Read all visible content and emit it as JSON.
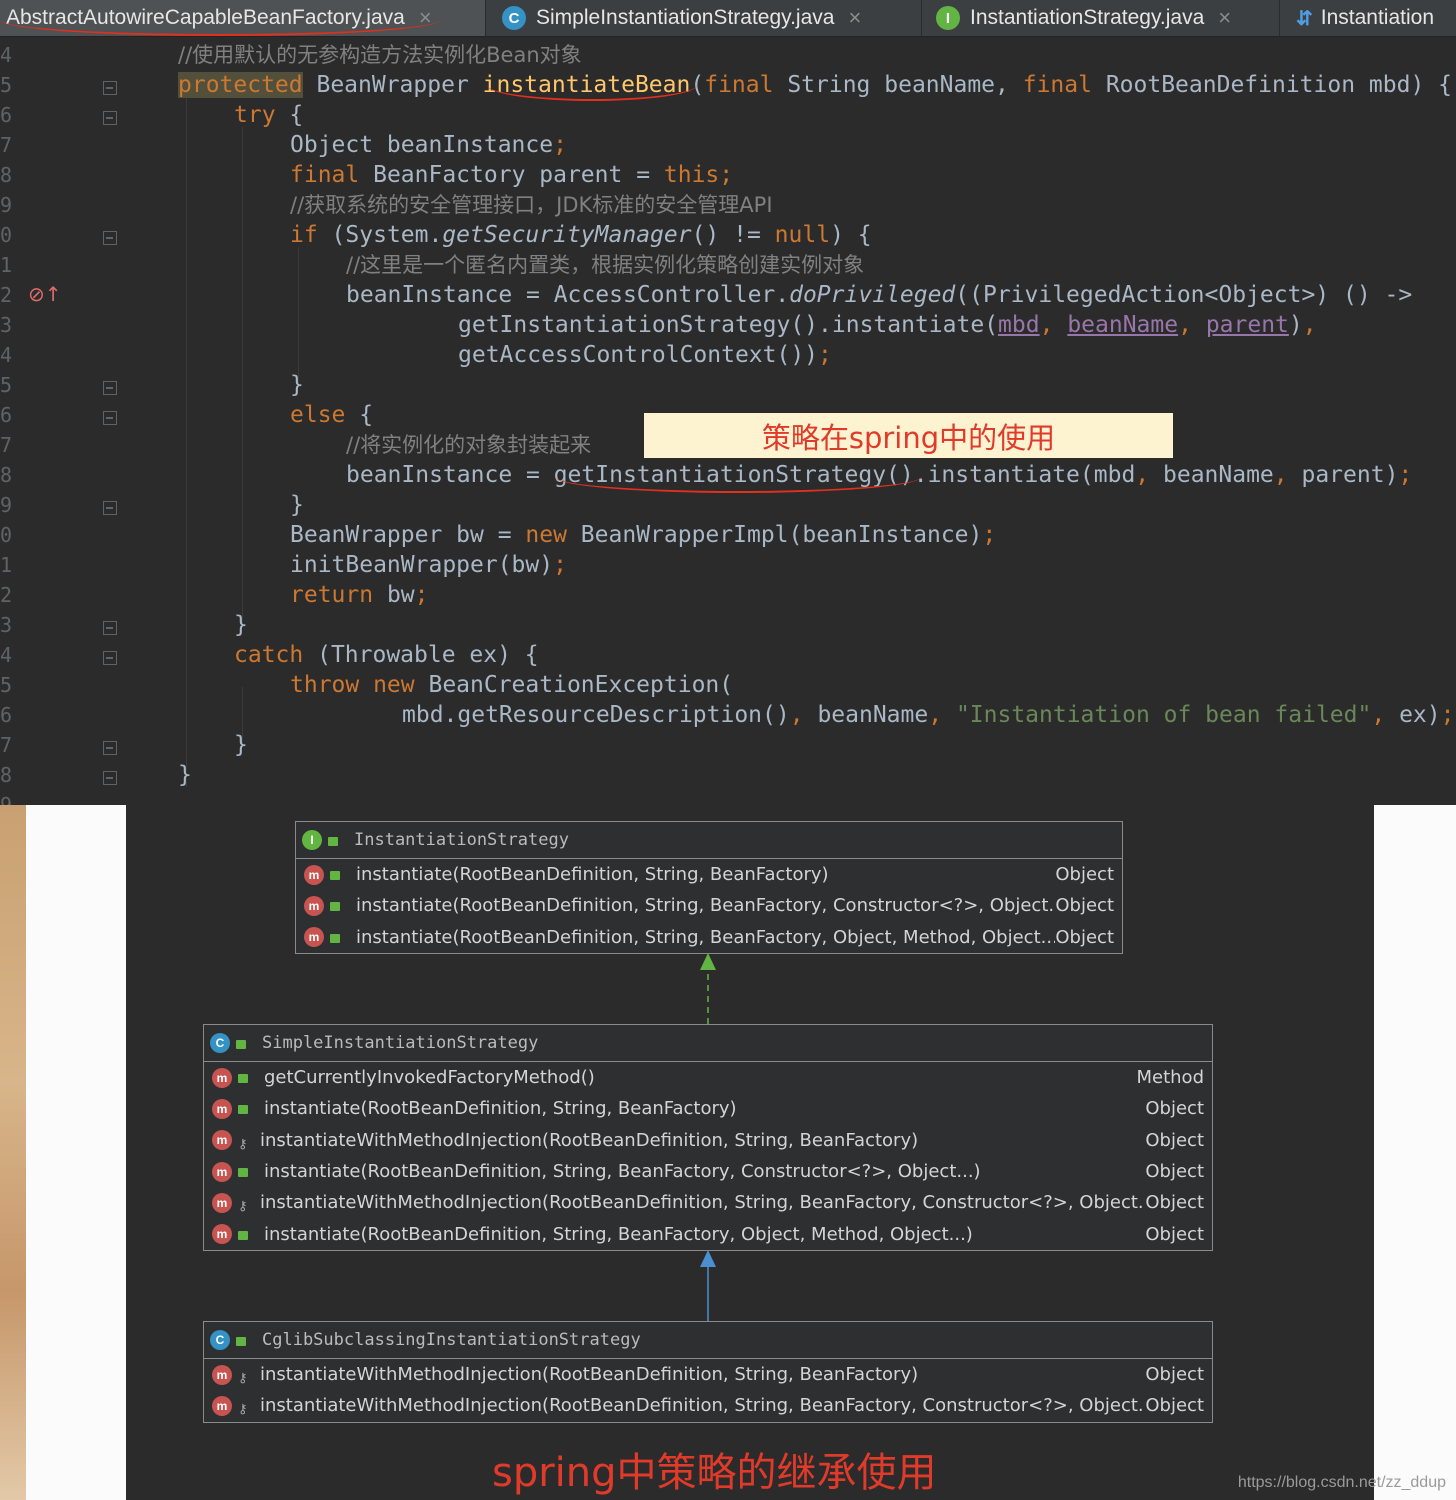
{
  "tabs": [
    {
      "label": "AbstractAutowireCapableBeanFactory.java",
      "icon": "none",
      "active": true
    },
    {
      "label": "SimpleInstantiationStrategy.java",
      "icon": "class-icon",
      "letter": "C"
    },
    {
      "label": "InstantiationStrategy.java",
      "icon": "interface-icon",
      "letter": "I"
    },
    {
      "label": "Instantiation",
      "icon": "structure-icon"
    }
  ],
  "tab_close_glyph": "×",
  "gutter_numbers": [
    "4",
    "5",
    "6",
    "7",
    "8",
    "9",
    "0",
    "1",
    "2",
    "3",
    "4",
    "5",
    "6",
    "7",
    "8",
    "9",
    "0",
    "1",
    "2",
    "3",
    "4",
    "5",
    "6",
    "7",
    "8",
    "9"
  ],
  "callout": "策略在spring中的使用",
  "diagram": {
    "interface": {
      "letter": "I",
      "name": "InstantiationStrategy",
      "methods": [
        {
          "sig": "instantiate(RootBeanDefinition, String, BeanFactory)",
          "ret": "Object"
        },
        {
          "sig": "instantiate(RootBeanDefinition, String, BeanFactory, Constructor<?>, Object...)",
          "ret": "Object"
        },
        {
          "sig": "instantiate(RootBeanDefinition, String, BeanFactory, Object, Method, Object...)",
          "ret": "Object"
        }
      ]
    },
    "simple": {
      "letter": "C",
      "name": "SimpleInstantiationStrategy",
      "methods": [
        {
          "sig": "getCurrentlyInvokedFactoryMethod()",
          "ret": "Method",
          "access": "public"
        },
        {
          "sig": "instantiate(RootBeanDefinition, String, BeanFactory)",
          "ret": "Object",
          "access": "public"
        },
        {
          "sig": "instantiateWithMethodInjection(RootBeanDefinition, String, BeanFactory)",
          "ret": "Object",
          "access": "protected"
        },
        {
          "sig": "instantiate(RootBeanDefinition, String, BeanFactory, Constructor<?>, Object...)",
          "ret": "Object",
          "access": "public"
        },
        {
          "sig": "instantiateWithMethodInjection(RootBeanDefinition, String, BeanFactory, Constructor<?>, Object...)",
          "ret": "Object",
          "access": "protected"
        },
        {
          "sig": "instantiate(RootBeanDefinition, String, BeanFactory, Object, Method, Object...)",
          "ret": "Object",
          "access": "public"
        }
      ]
    },
    "cglib": {
      "letter": "C",
      "name": "CglibSubclassingInstantiationStrategy",
      "methods": [
        {
          "sig": "instantiateWithMethodInjection(RootBeanDefinition, String, BeanFactory)",
          "ret": "Object",
          "access": "protected"
        },
        {
          "sig": "instantiateWithMethodInjection(RootBeanDefinition, String, BeanFactory, Constructor<?>, Object...)",
          "ret": "Object",
          "access": "protected"
        }
      ]
    },
    "method_icon_letter": "m",
    "caption": "spring中策略的继承使用"
  },
  "watermark": "https://blog.csdn.net/zz_ddup",
  "colors": {
    "keyword": "#cc7832",
    "comment": "#808080",
    "string": "#6a8759",
    "param": "#9876aa",
    "annotation_red": "#e03a2b"
  }
}
